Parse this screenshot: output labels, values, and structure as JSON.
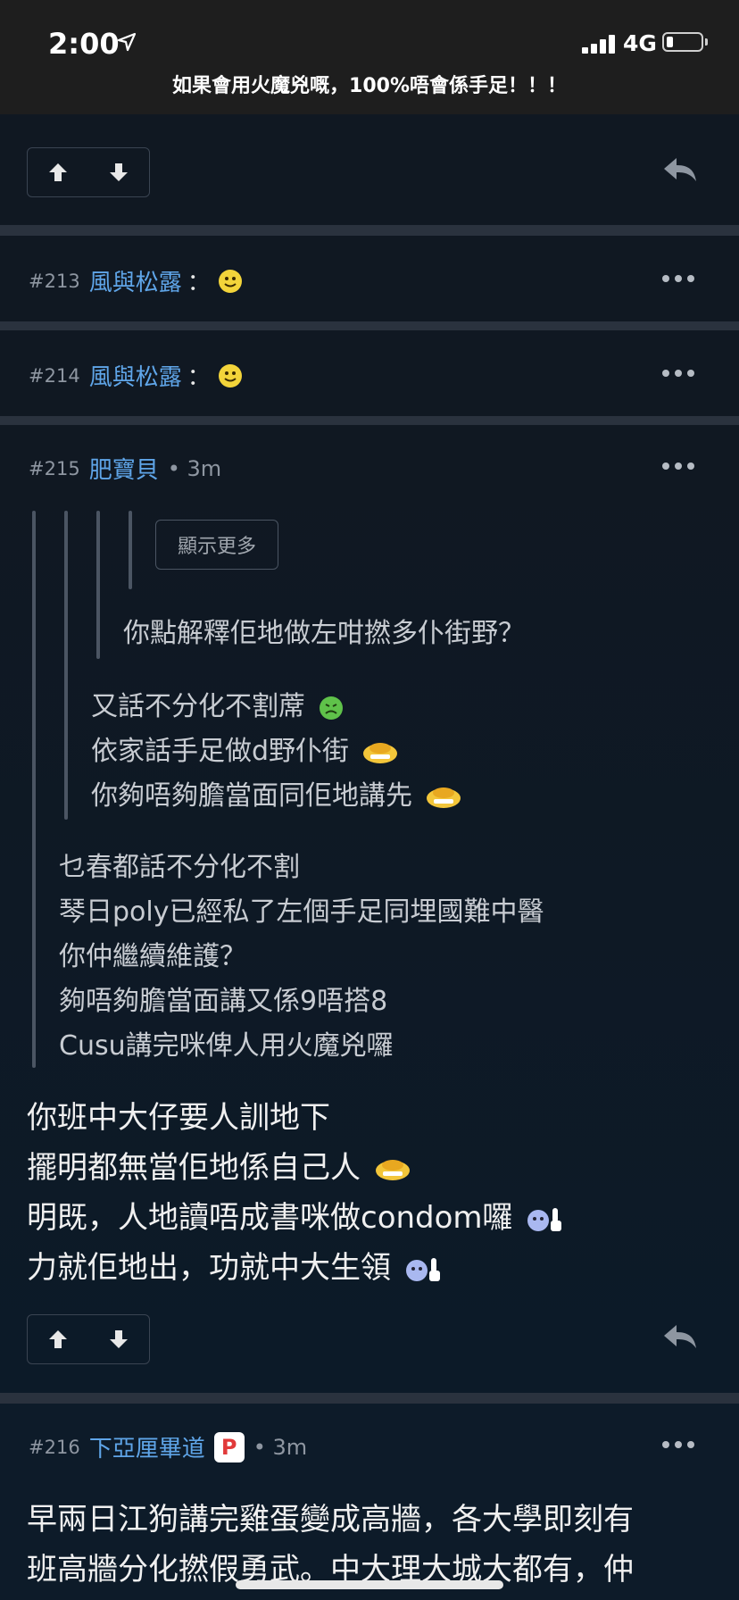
{
  "status": {
    "time": "2:00",
    "network": "4G",
    "battery_level": 0.2
  },
  "thread": {
    "title": "如果會用火魔兇嘅，100%唔會係手足！！！"
  },
  "posts": [
    {
      "number": "#213",
      "user": "風與松露",
      "colon": "："
    },
    {
      "number": "#214",
      "user": "風與松露",
      "colon": "："
    },
    {
      "number": "#215",
      "user": "肥寶貝",
      "time": "• 3m",
      "show_more": "顯示更多",
      "quote_lvl3": [
        "你點解釋佢地做左咁撚多仆街野？"
      ],
      "quote_lvl2": [
        "又話不分化不割蓆",
        "依家話手足做d野仆街",
        "你夠唔夠膽當面同佢地講先"
      ],
      "quote_lvl1": [
        "乜春都話不分化不割",
        "琴日poly已經私了左個手足同埋國難中醫",
        "你仲繼續維護？",
        "夠唔夠膽當面講又係9唔搭8",
        "Cusu講完咪俾人用火魔兇囉"
      ],
      "body": [
        "你班中大仔要人訓地下",
        "擺明都無當佢地係自己人",
        "明既，人地讀唔成書咪做condom囉",
        "力就佢地出，功就中大生領"
      ]
    },
    {
      "number": "#216",
      "user": "下亞厘畢道",
      "badge": "P",
      "time": "• 3m",
      "body": [
        "早兩日江狗講完雞蛋變成高牆，各大學即刻有",
        "班高牆分化撚假勇武。中大理大城大都有，仲"
      ]
    }
  ],
  "colors": {
    "background": "#0e1622",
    "username": "#5fa5e8",
    "separator": "#2a323e"
  }
}
